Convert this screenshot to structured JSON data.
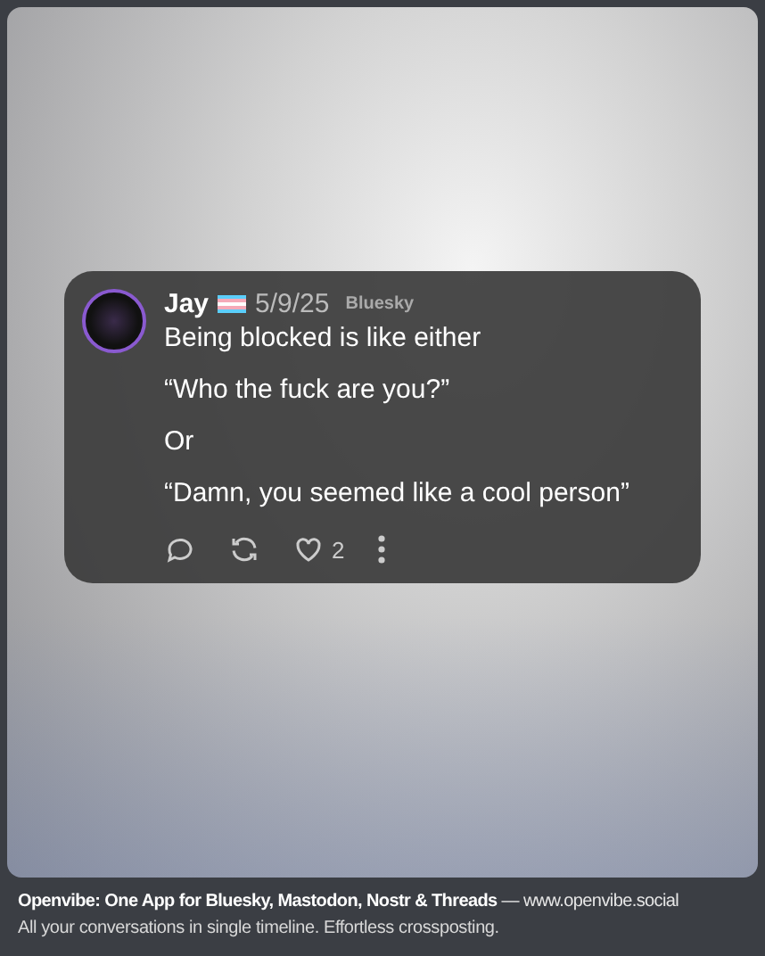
{
  "post": {
    "author": "Jay",
    "date": "5/9/25",
    "network": "Bluesky",
    "paragraphs": [
      "Being blocked is like either",
      "“Who the fuck are you?”",
      "Or",
      "“Damn, you seemed like a cool person”"
    ],
    "like_count": "2"
  },
  "footer": {
    "headline": "**Openvibe: One App for Bluesky, Mastodon, Nostr & Threads** — www.openvibe.social",
    "tagline": "All your conversations in single timeline. Effortless crossposting."
  }
}
